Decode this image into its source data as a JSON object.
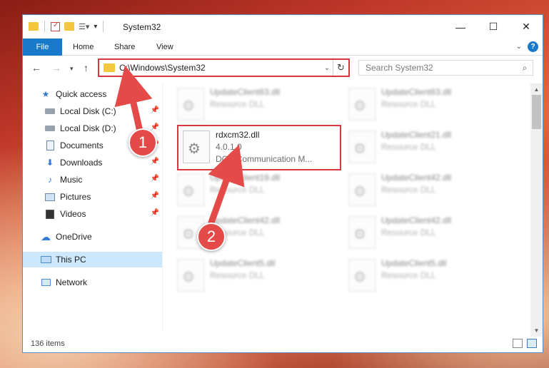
{
  "window": {
    "title": "System32",
    "controls": {
      "minimize": "—",
      "maximize": "☐",
      "close": "✕"
    }
  },
  "ribbon": {
    "file_tab": "File",
    "tabs": [
      "Home",
      "Share",
      "View"
    ],
    "help": "?"
  },
  "address": {
    "path": "C:\\Windows\\System32",
    "search_placeholder": "Search System32"
  },
  "nav": {
    "items": [
      {
        "label": "Quick access",
        "icon": "star-icon",
        "pinned": false
      },
      {
        "label": "Local Disk (C:)",
        "icon": "drive-icon",
        "pinned": true
      },
      {
        "label": "Local Disk (D:)",
        "icon": "drive-icon",
        "pinned": true
      },
      {
        "label": "Documents",
        "icon": "documents-icon",
        "pinned": true
      },
      {
        "label": "Downloads",
        "icon": "download-icon",
        "pinned": true
      },
      {
        "label": "Music",
        "icon": "music-icon",
        "pinned": true
      },
      {
        "label": "Pictures",
        "icon": "pictures-icon",
        "pinned": true
      },
      {
        "label": "Videos",
        "icon": "videos-icon",
        "pinned": true
      },
      {
        "label": "OneDrive",
        "icon": "cloud-icon",
        "pinned": false
      },
      {
        "label": "This PC",
        "icon": "monitor-icon",
        "pinned": false,
        "selected": true
      },
      {
        "label": "Network",
        "icon": "network-icon",
        "pinned": false
      }
    ]
  },
  "files": {
    "left": [
      {
        "name": "UpdateClient63.dll",
        "sub": "Resource DLL"
      },
      {
        "name": "rdxcm32.dll",
        "version": "4.0.1.0",
        "desc": "DCX Communication M..."
      },
      {
        "name": "UpdateClient19.dll",
        "sub": "Resource DLL"
      },
      {
        "name": "UpdateClient42.dll",
        "sub": "Resource DLL"
      },
      {
        "name": "UpdateClient5.dll",
        "sub": "Resource DLL"
      }
    ],
    "right": [
      {
        "name": "UpdateClient63.dll",
        "sub": "Resource DLL"
      },
      {
        "name": "UpdateClient21.dll",
        "sub": "Resource DLL"
      },
      {
        "name": "UpdateClient42.dll",
        "sub": "Resource DLL"
      },
      {
        "name": "UpdateClient42.dll",
        "sub": "Resource DLL"
      },
      {
        "name": "UpdateClient5.dll",
        "sub": "Resource DLL"
      }
    ]
  },
  "status": {
    "count": "136 items"
  },
  "annotations": {
    "step1": "1",
    "step2": "2",
    "color": "#e44a47"
  }
}
